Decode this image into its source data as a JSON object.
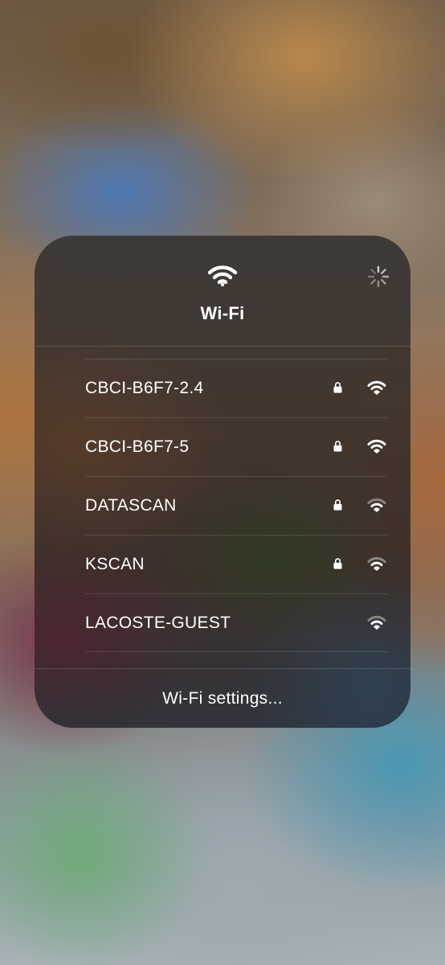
{
  "panel": {
    "title": "Wi-Fi",
    "header_icon": "wifi-icon",
    "loading_icon": "activity-spinner-icon"
  },
  "networks": [
    {
      "name": "CBCI-B6F7-2.4",
      "secured": true,
      "signal_bars": 3
    },
    {
      "name": "CBCI-B6F7-5",
      "secured": true,
      "signal_bars": 3
    },
    {
      "name": "DATASCAN",
      "secured": true,
      "signal_bars": 2
    },
    {
      "name": "KSCAN",
      "secured": true,
      "signal_bars": 2
    },
    {
      "name": "LACOSTE-GUEST",
      "secured": false,
      "signal_bars": 2
    }
  ],
  "footer": {
    "settings_label": "Wi-Fi settings..."
  },
  "colors": {
    "text": "#ffffff",
    "icon_active": "#ffffff",
    "icon_dim": "#8a8580"
  }
}
